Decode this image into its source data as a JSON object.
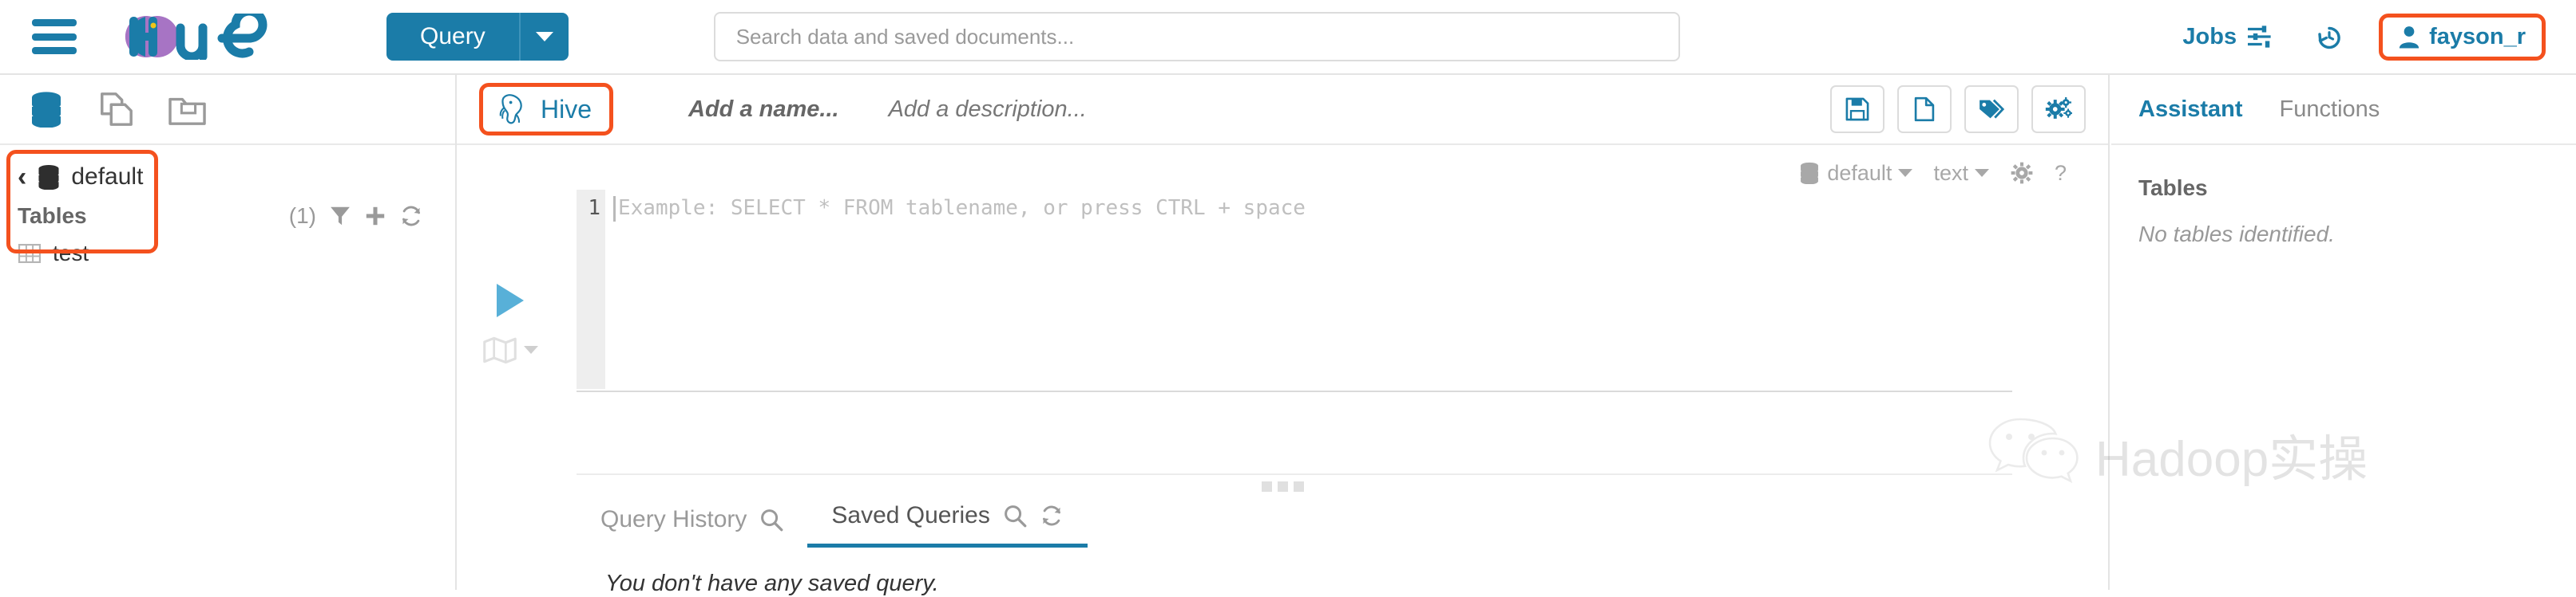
{
  "navbar": {
    "menu_icon": "hamburger-menu-icon",
    "logo_text": "hue",
    "query_button": "Query",
    "query_caret_icon": "chevron-down-icon",
    "search_placeholder": "Search data and saved documents...",
    "search_value": "",
    "jobs_label": "Jobs",
    "jobs_icon": "sliders-icon",
    "history_icon": "history-clock-icon",
    "user_icon": "user-icon",
    "user_name": "fayson_r",
    "accent_blue": "#1b7ca8",
    "highlight_orange": "#f4511e"
  },
  "sidebar": {
    "header_icons": [
      {
        "name": "database-stack-icon",
        "active": true
      },
      {
        "name": "documents-icon",
        "active": false
      },
      {
        "name": "browse-folder-icon",
        "active": false
      }
    ],
    "back_caret": "‹",
    "database_name": "default",
    "database_icon": "database-stack-icon",
    "tables_label": "Tables",
    "tables_count": "(1)",
    "filter_icon": "funnel-filter-icon",
    "add_icon": "plus-icon",
    "refresh_icon": "refresh-icon",
    "tables": [
      {
        "name": "test",
        "icon": "table-grid-icon"
      }
    ]
  },
  "editor": {
    "engine_tab": "Hive",
    "engine_icon": "hive-elephant-icon",
    "name_placeholder": "Add a name...",
    "description_placeholder": "Add a description...",
    "tools": [
      {
        "label": "Save",
        "icon": "floppy-save-icon"
      },
      {
        "label": "New",
        "icon": "new-document-icon"
      },
      {
        "label": "Tags",
        "icon": "tags-icon"
      },
      {
        "label": "Settings",
        "icon": "gears-settings-icon"
      }
    ],
    "options": {
      "database": "default",
      "database_icon": "database-stack-icon",
      "format": "text",
      "settings_icon": "gear-icon",
      "help_icon": "question-mark-icon"
    },
    "line_number": "1",
    "code_placeholder": "Example: SELECT * FROM tablename, or press CTRL + space",
    "code_value": "",
    "run_icon": "play-run-icon",
    "explain_icon": "map-explain-icon",
    "explain_caret_icon": "chevron-down-icon",
    "drag_handle_icon": "drag-handle-icon"
  },
  "results": {
    "tabs": [
      {
        "label": "Query History",
        "active": false,
        "icons": [
          "search-icon"
        ]
      },
      {
        "label": "Saved Queries",
        "active": true,
        "icons": [
          "search-icon",
          "refresh-icon"
        ]
      }
    ],
    "empty_message": "You don't have any saved query."
  },
  "assistant": {
    "tabs": [
      {
        "label": "Assistant",
        "active": true
      },
      {
        "label": "Functions",
        "active": false
      }
    ],
    "section_title": "Tables",
    "empty_message": "No tables identified."
  },
  "watermark": {
    "icon": "wechat-logo-icon",
    "text": "Hadoop实操"
  }
}
